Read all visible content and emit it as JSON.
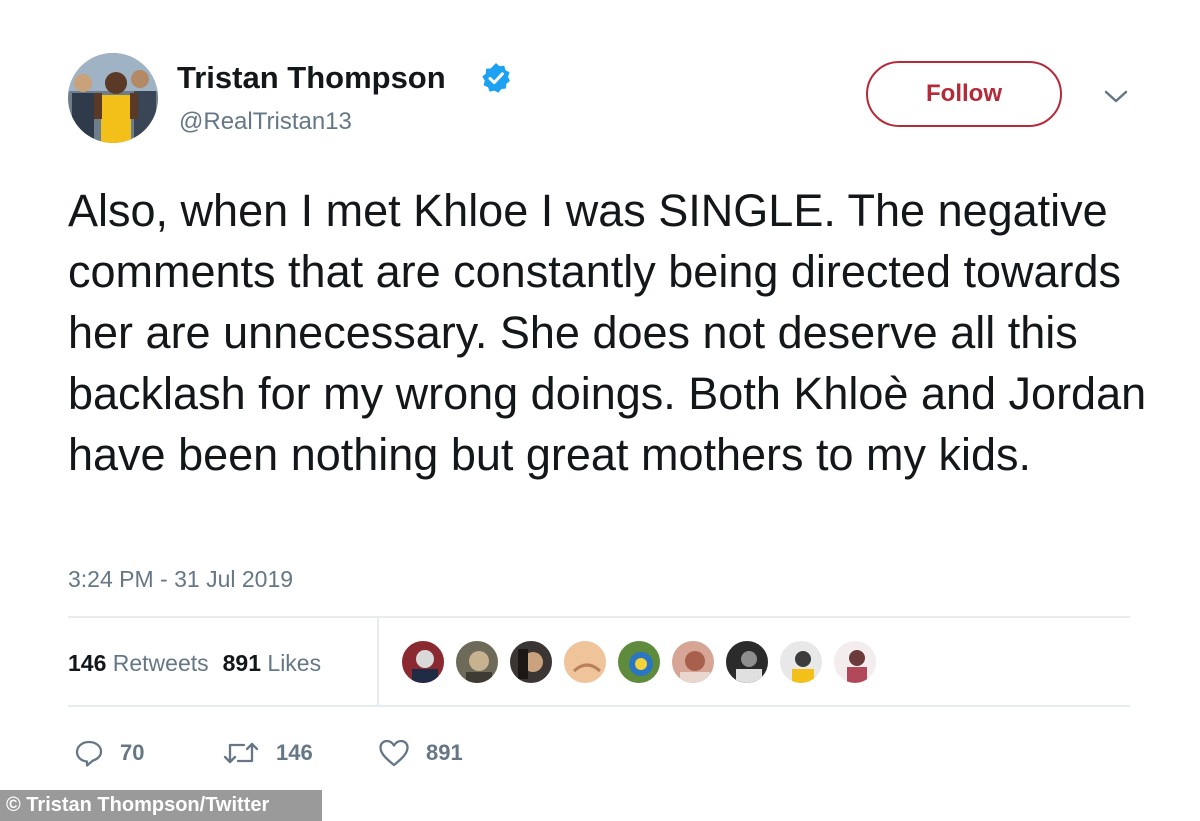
{
  "author": {
    "display_name": "Tristan Thompson",
    "handle": "@RealTristan13",
    "verified": true,
    "avatar_icon": "profile-photo"
  },
  "follow_button": {
    "label": "Follow",
    "color": "#b52a39"
  },
  "menu": {
    "icon": "chevron-down-icon"
  },
  "tweet": {
    "text": "Also, when I met Khloe I was SINGLE. The negative comments that are constantly being directed towards her are unnecessary. She does not deserve all this backlash for my wrong doings. Both Khloè and Jordan have been nothing but great mothers to my kids.",
    "timestamp": "3:24 PM - 31 Jul 2019"
  },
  "stats": {
    "retweets_count": "146",
    "retweets_label": "Retweets",
    "likes_count": "891",
    "likes_label": "Likes"
  },
  "liked_by": [
    {
      "icon": "liker-avatar"
    },
    {
      "icon": "liker-avatar"
    },
    {
      "icon": "liker-avatar"
    },
    {
      "icon": "liker-avatar"
    },
    {
      "icon": "liker-avatar"
    },
    {
      "icon": "liker-avatar"
    },
    {
      "icon": "liker-avatar"
    },
    {
      "icon": "liker-avatar"
    },
    {
      "icon": "liker-avatar"
    }
  ],
  "actions": {
    "reply": {
      "icon": "reply-icon",
      "count": "70"
    },
    "retweet": {
      "icon": "retweet-icon",
      "count": "146"
    },
    "like": {
      "icon": "heart-icon",
      "count": "891"
    }
  },
  "credit": {
    "text": "© Tristan Thompson/Twitter"
  },
  "colors": {
    "text": "#14171a",
    "secondary": "#657786",
    "divider": "#e6ecf0",
    "verified": "#1da1f2"
  }
}
